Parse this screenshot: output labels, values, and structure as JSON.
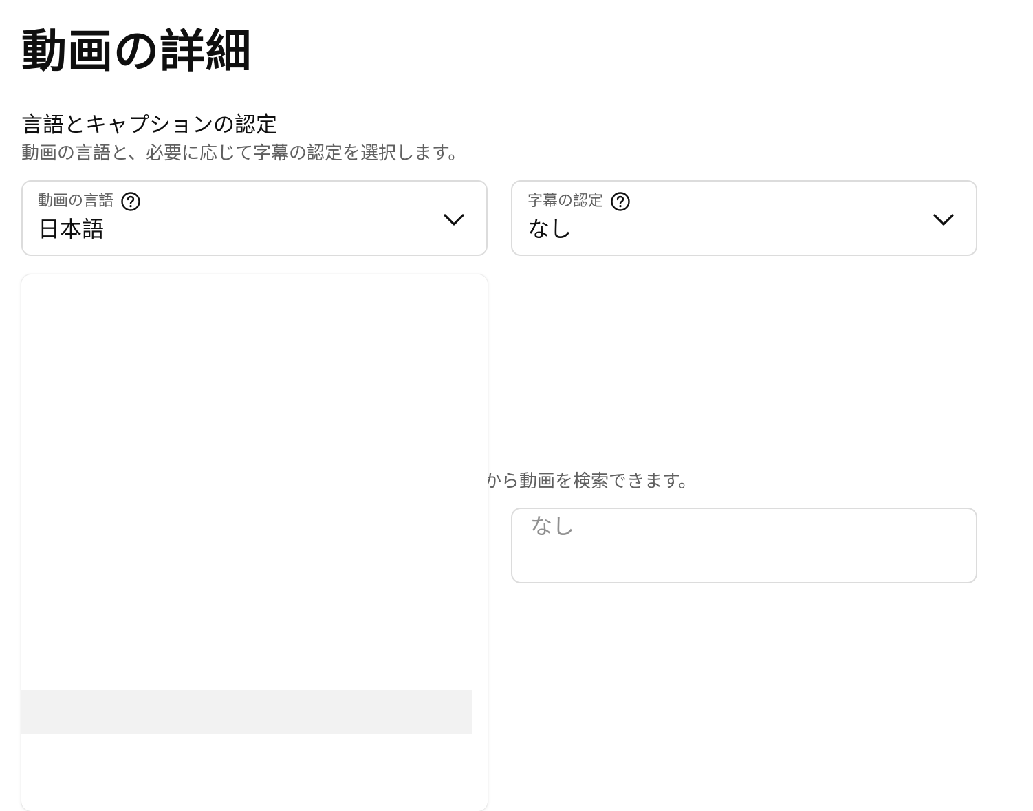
{
  "page": {
    "title": "動画の詳細"
  },
  "language_section": {
    "title": "言語とキャプションの認定",
    "description": "動画の言語と、必要に応じて字幕の認定を選択します。"
  },
  "video_language": {
    "label": "動画の言語",
    "value": "日本語"
  },
  "caption_certification": {
    "label": "字幕の認定",
    "value": "なし"
  },
  "search_section": {
    "visible_description": "から動画を検索できます。"
  },
  "search_input": {
    "placeholder": "なし"
  },
  "icons": {
    "help": "help-circle-icon",
    "dropdown": "chevron-down-icon"
  },
  "colors": {
    "text_primary": "#0f0f0f",
    "text_secondary": "#606060",
    "border": "#dcdcdc",
    "highlight": "#f2f2f2"
  }
}
